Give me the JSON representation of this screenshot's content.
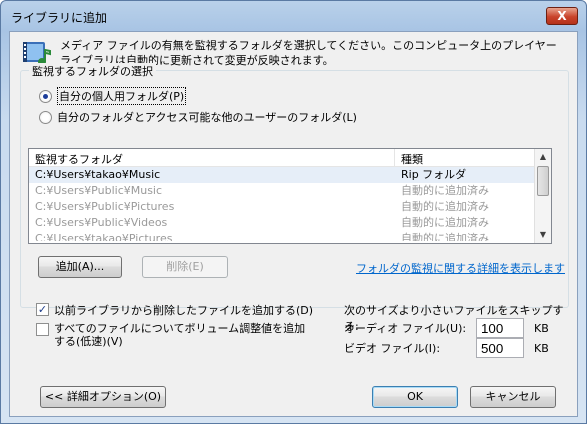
{
  "window": {
    "title": "ライブラリに追加",
    "close_label": "X"
  },
  "description": "メディア ファイルの有無を監視するフォルダを選択してください。このコンピュータ上のプレイヤー ライブラリは自動的に更新されて変更が反映されます。",
  "group": {
    "legend": "監視するフォルダの選択",
    "radio_personal": "自分の個人用フォルダ(P)",
    "radio_all": "自分のフォルダとアクセス可能な他のユーザーのフォルダ(L)"
  },
  "folder_list": {
    "headers": {
      "folder": "監視するフォルダ",
      "type": "種類"
    },
    "rows": [
      {
        "folder": "C:¥Users¥takao¥Music",
        "type": "Rip フォルダ"
      },
      {
        "folder": "C:¥Users¥Public¥Music",
        "type": "自動的に追加済み"
      },
      {
        "folder": "C:¥Users¥Public¥Pictures",
        "type": "自動的に追加済み"
      },
      {
        "folder": "C:¥Users¥Public¥Videos",
        "type": "自動的に追加済み"
      },
      {
        "folder": "C:¥Users¥takao¥Pictures",
        "type": "自動的に追加済み"
      }
    ]
  },
  "buttons": {
    "add": "追加(A)...",
    "remove": "削除(E)",
    "advanced": "<< 詳細オプション(O)",
    "ok": "OK",
    "cancel": "キャンセル"
  },
  "details_link": "フォルダの監視に関する詳細を表示します",
  "options": {
    "add_deleted": "以前ライブラリから削除したファイルを追加する(D)",
    "add_deleted_checked": true,
    "volume_leveling": "すべてのファイルについてボリューム調整値を追加する(低速)(V)",
    "volume_leveling_checked": false
  },
  "skip": {
    "heading": "次のサイズより小さいファイルをスキップする:",
    "audio_label": "オーディオ ファイル(U):",
    "audio_value": "100",
    "video_label": "ビデオ ファイル(I):",
    "video_value": "500",
    "unit": "KB"
  },
  "colors": {
    "accent": "#0066cc",
    "title_bar": "#b9d1ea",
    "close": "#c9432b"
  },
  "icons": [
    "media-library-icon",
    "close-icon",
    "scroll-up-icon",
    "scroll-down-icon",
    "checkmark-icon"
  ]
}
